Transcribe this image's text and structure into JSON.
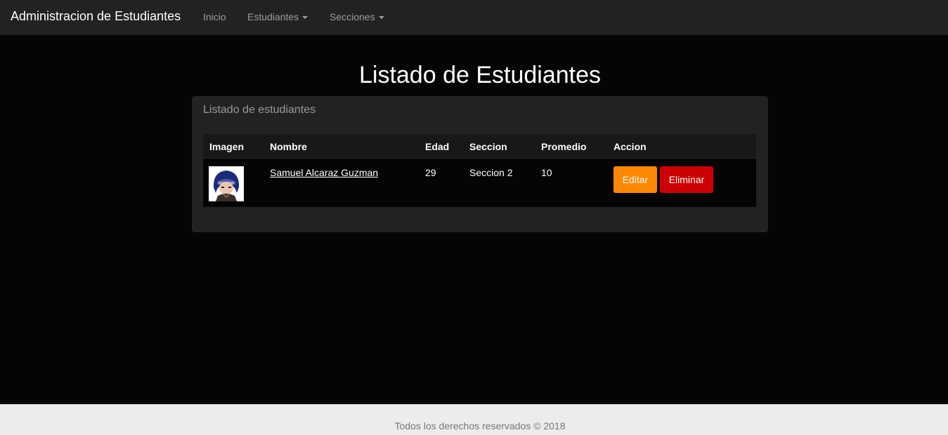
{
  "navbar": {
    "brand": "Administracion de Estudiantes",
    "items": [
      {
        "label": "Inicio"
      },
      {
        "label": "Estudiantes"
      },
      {
        "label": "Secciones"
      }
    ]
  },
  "main": {
    "title": "Listado de Estudiantes",
    "panel": {
      "heading": "Listado de estudiantes",
      "columns": [
        "Imagen",
        "Nombre",
        "Edad",
        "Seccion",
        "Promedio",
        "Accion"
      ],
      "rows": [
        {
          "image_icon": "student-avatar",
          "nombre": "Samuel Alcaraz Guzman",
          "edad": "29",
          "seccion": "Seccion 2",
          "promedio": "10",
          "edit_label": "Editar",
          "delete_label": "Eliminar"
        }
      ]
    }
  },
  "footer": {
    "text": "Todos los derechos reservados © 2018"
  },
  "colors": {
    "navbar_bg": "#222222",
    "page_bg": "#050505",
    "edit_button": "#ff8800",
    "delete_button": "#cc0000",
    "footer_bg": "#ececec"
  }
}
